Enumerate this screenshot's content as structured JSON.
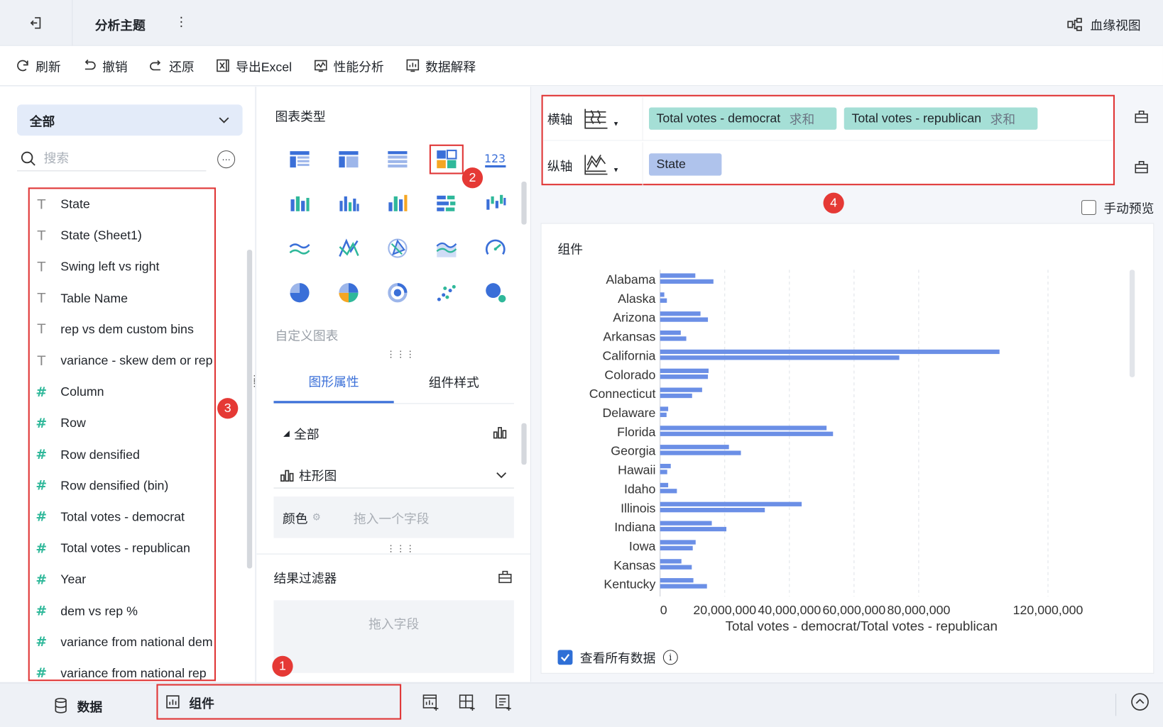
{
  "topbar": {
    "title": "分析主题",
    "more": "⋮",
    "lineage_label": "血缘视图"
  },
  "toolbar": [
    {
      "label": "刷新",
      "icon": "refresh-icon"
    },
    {
      "label": "撤销",
      "icon": "undo-icon"
    },
    {
      "label": "还原",
      "icon": "redo-icon"
    },
    {
      "label": "导出Excel",
      "icon": "excel-icon"
    },
    {
      "label": "性能分析",
      "icon": "performance-icon"
    },
    {
      "label": "数据解释",
      "icon": "data-explain-icon"
    }
  ],
  "left_panel": {
    "category": "全部",
    "search_placeholder": "搜索",
    "fields": [
      {
        "type": "T",
        "name": "State"
      },
      {
        "type": "T",
        "name": "State (Sheet1)"
      },
      {
        "type": "T",
        "name": "Swing left vs right"
      },
      {
        "type": "T",
        "name": "Table Name"
      },
      {
        "type": "T",
        "name": "rep vs dem custom bins"
      },
      {
        "type": "T",
        "name": "variance - skew dem or rep"
      },
      {
        "type": "#",
        "name": "Column"
      },
      {
        "type": "#",
        "name": "Row"
      },
      {
        "type": "#",
        "name": "Row densified"
      },
      {
        "type": "#",
        "name": "Row densified (bin)"
      },
      {
        "type": "#",
        "name": "Total votes - democrat"
      },
      {
        "type": "#",
        "name": "Total votes - republican"
      },
      {
        "type": "#",
        "name": "Year"
      },
      {
        "type": "#",
        "name": "dem vs rep %"
      },
      {
        "type": "#",
        "name": "variance from national dem"
      },
      {
        "type": "#",
        "name": "variance from national rep"
      }
    ]
  },
  "middle_panel": {
    "chart_type_title": "图表类型",
    "custom_chart_label": "自定义图表",
    "tabs": [
      "图形属性",
      "组件样式"
    ],
    "all_label": "全部",
    "chart_select": "柱形图",
    "color_label": "颜色",
    "color_placeholder": "拖入一个字段",
    "filter_title": "结果过滤器",
    "filter_placeholder": "拖入字段"
  },
  "right_panel": {
    "x_axis_label": "横轴",
    "y_axis_label": "纵轴",
    "x_fields": [
      {
        "name": "Total votes - democrat",
        "agg": "求和"
      },
      {
        "name": "Total votes - republican",
        "agg": "求和"
      }
    ],
    "y_fields": [
      {
        "name": "State"
      }
    ],
    "manual_preview": "手动预览",
    "card_title": "组件",
    "view_all": "查看所有数据"
  },
  "bottom": {
    "data_tab": "数据",
    "component_tab": "组件"
  },
  "badges": [
    "1",
    "2",
    "3",
    "4"
  ],
  "colors": {
    "accent": "#3a6fd8",
    "bar": "#6b8fe6",
    "highlight_box": "#e03636",
    "badge": "#e53935"
  },
  "chart_data": {
    "type": "bar",
    "orientation": "horizontal",
    "categories": [
      "Alabama",
      "Alaska",
      "Arizona",
      "Arkansas",
      "California",
      "Colorado",
      "Connecticut",
      "Delaware",
      "Florida",
      "Georgia",
      "Hawaii",
      "Idaho",
      "Illinois",
      "Indiana",
      "Iowa",
      "Kansas",
      "Kentucky"
    ],
    "series": [
      {
        "name": "Total votes - democrat",
        "values": [
          10900000,
          1300000,
          12500000,
          6400000,
          105000000,
          15000000,
          13000000,
          2500000,
          51500000,
          21300000,
          3300000,
          2500000,
          43800000,
          16000000,
          11000000,
          6600000,
          10300000
        ]
      },
      {
        "name": "Total votes - republican",
        "values": [
          16500000,
          2100000,
          14800000,
          8100000,
          74000000,
          14800000,
          9900000,
          2000000,
          53500000,
          25000000,
          2200000,
          5200000,
          32400000,
          20500000,
          10100000,
          9800000,
          14500000
        ]
      }
    ],
    "xlabel": "Total votes - democrat/Total votes - republican",
    "xticks": [
      "0",
      "20,000,000",
      "40,000,000",
      "60,000,000",
      "80,000,000",
      "120,000,000"
    ],
    "xtick_values": [
      0,
      20000000,
      40000000,
      60000000,
      80000000,
      120000000
    ],
    "xlim": [
      0,
      120000000
    ],
    "grid": true
  }
}
